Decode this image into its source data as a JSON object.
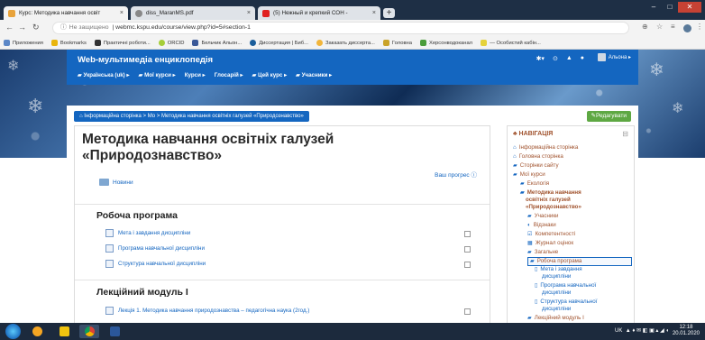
{
  "browser": {
    "tabs": [
      {
        "title": "Курс: Методика навчання освіт",
        "fav": "#e8a33b"
      },
      {
        "title": "diss_MaranMS.pdf",
        "fav": "#888888"
      },
      {
        "title": "(5) Нежный и крепкий СОН - ",
        "fav": "#e02020"
      }
    ],
    "address_security": "Не защищено",
    "address_url": "webmc.kspu.edu/course/view.php?id=5#section-1",
    "bookmarks": [
      {
        "label": "Приложения",
        "color": "#5b87c7"
      },
      {
        "label": "Bookmarks",
        "color": "#e9b50c"
      },
      {
        "label": "Практичні роботи...",
        "color": "#333333"
      },
      {
        "label": "ORCID",
        "color": "#a6ce39"
      },
      {
        "label": "Бельчик Альон...",
        "color": "#3b5998"
      },
      {
        "label": "Диссертация | Биб...",
        "color": "#1b5e9b"
      },
      {
        "label": "Заказать диссерта...",
        "color": "#f2b53a"
      },
      {
        "label": "Головна",
        "color": "#c9a32a"
      },
      {
        "label": "Херсонводоканал",
        "color": "#4a9c3a"
      },
      {
        "label": "— Особистий кабін...",
        "color": "#e5d23b"
      }
    ]
  },
  "site": {
    "name": "Web-мультимедіа енциклопедія",
    "user": "Альона",
    "menu": [
      "Українська (uk)",
      "Мої курси",
      "Курси",
      "Глосарій",
      "Цей курс",
      "Учасники"
    ]
  },
  "breadcrumb": "Інформаційна сторінка  >  Мо  >  Методика навчання освітніх галузей «Природознавство»",
  "edit_button": "Редагувати",
  "course": {
    "title_line1": "Методика навчання освітніх галузей",
    "title_line2": "«Природознавство»",
    "progress_label": "Ваш прогрес",
    "news": "Новини"
  },
  "sections": [
    {
      "title": "Робоча програма",
      "items": [
        "Мета і завдання дисципліни",
        "Програма навчальної дисципліни",
        "Структура навчальної дисципліни"
      ]
    },
    {
      "title": "Лекційний модуль І",
      "items": [
        "Лекція 1. Методика навчання природознавства – педагогічна наука (2год.)"
      ]
    }
  ],
  "nav": {
    "title": "НАВІГАЦІЯ",
    "items": [
      "Інформаційна сторінка",
      "Головна сторінка",
      "Сторінки сайту",
      "Мої курси",
      "Екологія",
      "Методика навчання",
      "освітніх галузей",
      "«Природознавство»",
      "Учасники",
      "Відзнаки",
      "Компетентності",
      "Журнал оцінок",
      "Загальне",
      "Робоча програма",
      "Мета і завдання",
      "дисципліни",
      "Програма навчальної",
      "дисципліни",
      "Структура навчальної",
      "дисципліни",
      "Лекційний модуль І"
    ]
  },
  "taskbar": {
    "tray": "UK",
    "time": "12:18",
    "date": "20.01.2020"
  }
}
